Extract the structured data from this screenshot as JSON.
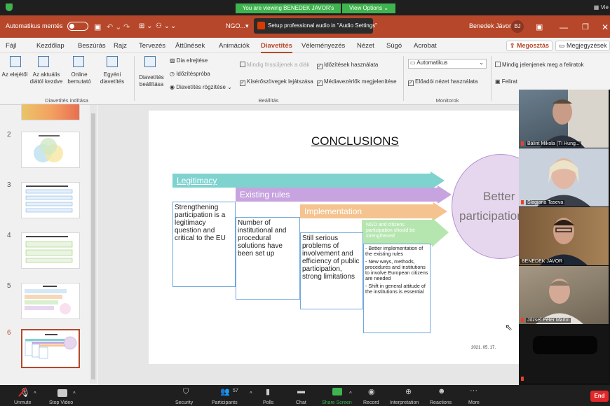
{
  "zoom": {
    "share_banner": "You are viewing BENEDEK JAVOR's screen",
    "view_options": "View Options ⌄",
    "view_right": "▦ Vie"
  },
  "titlebar": {
    "autosave": "Automatikus mentés",
    "filename": "NGO...",
    "audio_popup": "Setup professional audio in \"Audio Settings\"",
    "user": "Benedek Jávor",
    "initials": "BJ"
  },
  "menu": {
    "tabs": [
      "Fájl",
      "Kezdőlap",
      "Beszúrás",
      "Rajz",
      "Tervezés",
      "Áttűnések",
      "Animációk",
      "Diavetítés",
      "Véleményezés",
      "Nézet",
      "Súgó",
      "Acrobat"
    ],
    "share": "Megosztás",
    "comments": "Megjegyzések"
  },
  "ribbon": {
    "from_start": "Az elejétől",
    "from_current": "Az aktuális diától kezdve",
    "online": "Online bemutató",
    "custom": "Egyéni diavetítés",
    "group_start": "Diavetítés indítása",
    "setup": "Diavetítés beállítása",
    "hide_slide": "Dia elrejtése",
    "rehearse": "Időzítéspróba",
    "record": "Diavetítés rögzítése",
    "keep_fresh": "Mindig frissüljenek a diák",
    "use_timings": "Időzítések használata",
    "play_narrations": "Kísérőszövegek lejátszása",
    "show_media": "Médiavezérlők megjelenítése",
    "group_setup": "Beállítás",
    "monitor": "Automatikus",
    "presenter_view": "Előadói nézet használata",
    "group_monitors": "Monitorok",
    "always_subtitles": "Mindig jelenjenek meg a feliratok",
    "subtitles": "Felirat"
  },
  "thumbs": {
    "numbers": [
      "2",
      "3",
      "4",
      "5",
      "6"
    ]
  },
  "slide": {
    "title": "CONCLUSIONS",
    "band1": "Legitimacy",
    "band2": "Existing rules",
    "band3": "Implementation",
    "band4": "NGO and citizens participation should be strengthened",
    "box1": "Strengthening participation is a legitimacy question and critical to the EU",
    "box2": "Number of institutional and procedural solutions have been set up",
    "box3": "Still serious problems of involvement and efficiency of public participation, strong limitations",
    "box4_1": "- Better implementation of the existing rules",
    "box4_2": "- New ways, methods, procedures and institutions to involve European citizens are needed",
    "box4_3": "- Shift in general attitude of the institutions is essential",
    "circle_line1": "Better",
    "circle_line2": "participation",
    "date": "2021. 05. 17."
  },
  "participants": [
    {
      "name": "Bálint Mikola (TI Hung..."
    },
    {
      "name": "Slagjana Taseva"
    },
    {
      "name": "BENEDEK JAVOR"
    },
    {
      "name": "József Péter Martin"
    },
    {
      "name": ""
    }
  ],
  "toolbar": {
    "unmute": "Unmute",
    "stop_video": "Stop Video",
    "security": "Security",
    "participants": "Participants",
    "participants_count": "57",
    "polls": "Polls",
    "chat": "Chat",
    "share_screen": "Share Screen",
    "record": "Record",
    "interpretation": "Interpretation",
    "reactions": "Reactions",
    "more": "More",
    "end": "End"
  },
  "colors": {
    "ppt_red": "#b7472a",
    "zoom_green": "#3fb34f",
    "band1": "#7fd3cf",
    "band2": "#c7a4e0",
    "band3": "#f4c38f",
    "band4": "#b6e6b0"
  }
}
